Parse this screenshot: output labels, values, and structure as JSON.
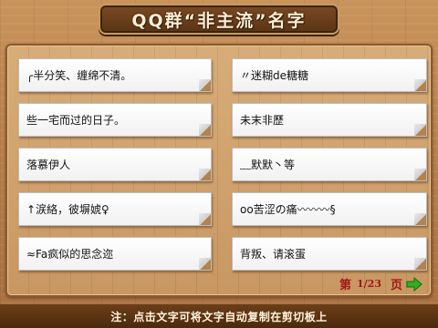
{
  "header": {
    "title": "QQ群“非主流”名字"
  },
  "names": {
    "left": [
      "╭半分笑、缠绵不清。",
      "些一宅而过的日子。",
      "落慕伊人",
      "↑涙絡，彼塀婋♀",
      "≈Fa疯似的思念迩"
    ],
    "right": [
      "〃迷糊de糖糖",
      "未末非歷",
      "﹏默默丶等",
      "oo苦涩の痛〰〰〰§",
      "背叛、请滚蛋"
    ]
  },
  "pager": {
    "prefix": "第",
    "page": "1/23",
    "suffix": "页"
  },
  "footer": {
    "note": "注：点击文字可将文字自动复制在剪切板上"
  },
  "colors": {
    "accent_red": "#a0181a",
    "next_arrow": "#2fb11f"
  }
}
